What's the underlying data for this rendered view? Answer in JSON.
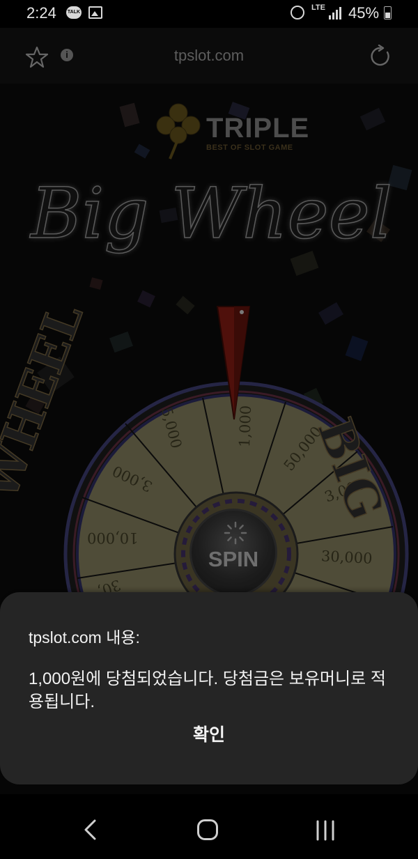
{
  "status_bar": {
    "time": "2:24",
    "talk_badge": "TALK",
    "network": "LTE",
    "battery": "45%"
  },
  "browser": {
    "url": "tpslot.com",
    "info_glyph": "i"
  },
  "brand": {
    "name": "TRIPLE",
    "tagline": "BEST OF SLOT GAME"
  },
  "wheel": {
    "title": "Big Wheel",
    "side_left": "WHEEL",
    "side_right": "BIG",
    "segments": [
      "1,000",
      "50,000",
      "3,000",
      "30,000",
      "5,000",
      "3,000",
      "10,000",
      "30,"
    ],
    "spin_label": "SPIN"
  },
  "dialog": {
    "title": "tpslot.com 내용:",
    "message": "1,000원에 당첨되었습니다. 당첨금은 보유머니로 적용됩니다.",
    "confirm_label": "확인"
  },
  "colors": {
    "dialog_bg": "#252525",
    "wheel_segment": "#bdb787",
    "pointer": "#9a1e14"
  }
}
